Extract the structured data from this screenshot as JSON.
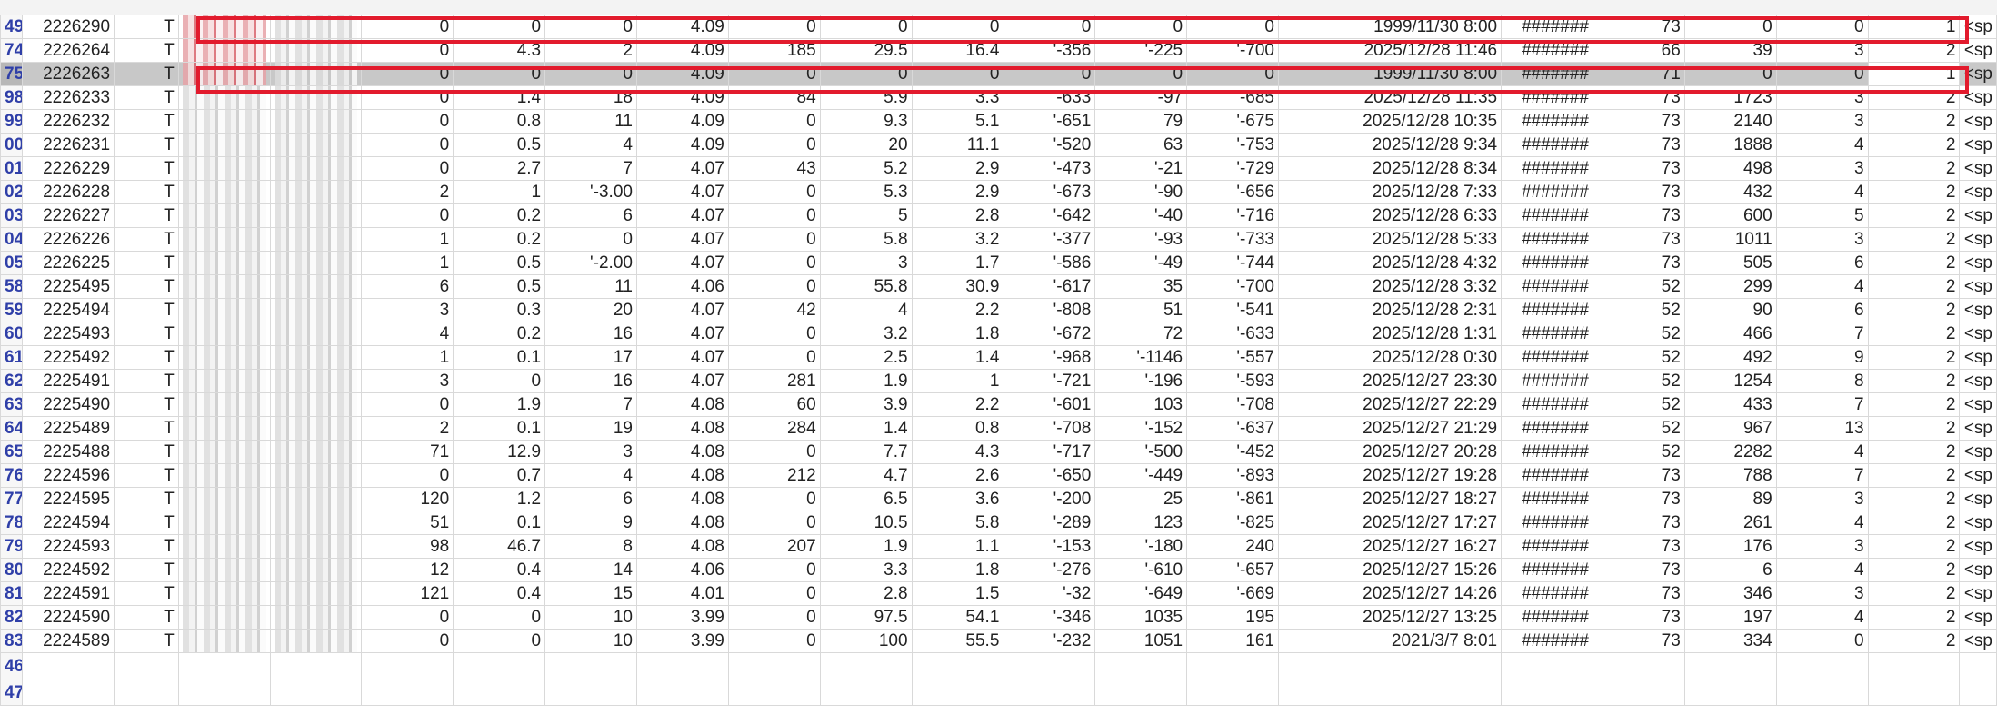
{
  "accent_colors": {
    "highlight": "#e21b2d",
    "row_number_text": "#2f3fa8",
    "selected_row": "#c8c8c8"
  },
  "rows": [
    {
      "rownum": "49",
      "id": "2226290",
      "prefix": "T",
      "c4": "0",
      "c5": "0",
      "c6": "0",
      "c7": "4.09",
      "c8": "0",
      "c9": "0",
      "c10": "0",
      "c11": "0",
      "c12": "0",
      "c13": "0",
      "date": "1999/11/30 8:00",
      "hash": "#######",
      "c16": "73",
      "c17": "0",
      "c18": "0",
      "c19": "1",
      "tail": "<sp",
      "highlight": true,
      "selected": false,
      "redblur": true
    },
    {
      "rownum": "74",
      "id": "2226264",
      "prefix": "T",
      "c4": "0",
      "c5": "4.3",
      "c6": "2",
      "c7": "4.09",
      "c8": "185",
      "c9": "29.5",
      "c10": "16.4",
      "c11": "'-356",
      "c12": "'-225",
      "c13": "'-700",
      "date": "2025/12/28 11:46",
      "hash": "#######",
      "c16": "66",
      "c17": "39",
      "c18": "3",
      "c19": "2",
      "tail": "<sp",
      "highlight": false,
      "selected": false,
      "redblur": true
    },
    {
      "rownum": "75",
      "id": "2226263",
      "prefix": "T",
      "c4": "0",
      "c5": "0",
      "c6": "0",
      "c7": "4.09",
      "c8": "0",
      "c9": "0",
      "c10": "0",
      "c11": "0",
      "c12": "0",
      "c13": "0",
      "date": "1999/11/30 8:00",
      "hash": "#######",
      "c16": "71",
      "c17": "0",
      "c18": "0",
      "c19": "1",
      "tail": "<sp",
      "highlight": true,
      "selected": true,
      "redblur": true
    },
    {
      "rownum": "98",
      "id": "2226233",
      "prefix": "T",
      "c4": "0",
      "c5": "1.4",
      "c6": "18",
      "c7": "4.09",
      "c8": "84",
      "c9": "5.9",
      "c10": "3.3",
      "c11": "'-633",
      "c12": "'-97",
      "c13": "'-685",
      "date": "2025/12/28 11:35",
      "hash": "#######",
      "c16": "73",
      "c17": "1723",
      "c18": "3",
      "c19": "2",
      "tail": "<sp"
    },
    {
      "rownum": "99",
      "id": "2226232",
      "prefix": "T",
      "c4": "0",
      "c5": "0.8",
      "c6": "11",
      "c7": "4.09",
      "c8": "0",
      "c9": "9.3",
      "c10": "5.1",
      "c11": "'-651",
      "c12": "79",
      "c13": "'-675",
      "date": "2025/12/28 10:35",
      "hash": "#######",
      "c16": "73",
      "c17": "2140",
      "c18": "3",
      "c19": "2",
      "tail": "<sp"
    },
    {
      "rownum": "00",
      "id": "2226231",
      "prefix": "T",
      "c4": "0",
      "c5": "0.5",
      "c6": "4",
      "c7": "4.09",
      "c8": "0",
      "c9": "20",
      "c10": "11.1",
      "c11": "'-520",
      "c12": "63",
      "c13": "'-753",
      "date": "2025/12/28 9:34",
      "hash": "#######",
      "c16": "73",
      "c17": "1888",
      "c18": "4",
      "c19": "2",
      "tail": "<sp"
    },
    {
      "rownum": "01",
      "id": "2226229",
      "prefix": "T",
      "c4": "0",
      "c5": "2.7",
      "c6": "7",
      "c7": "4.07",
      "c8": "43",
      "c9": "5.2",
      "c10": "2.9",
      "c11": "'-473",
      "c12": "'-21",
      "c13": "'-729",
      "date": "2025/12/28 8:34",
      "hash": "#######",
      "c16": "73",
      "c17": "498",
      "c18": "3",
      "c19": "2",
      "tail": "<sp"
    },
    {
      "rownum": "02",
      "id": "2226228",
      "prefix": "T",
      "c4": "2",
      "c5": "1",
      "c6": "'-3.00",
      "c7": "4.07",
      "c8": "0",
      "c9": "5.3",
      "c10": "2.9",
      "c11": "'-673",
      "c12": "'-90",
      "c13": "'-656",
      "date": "2025/12/28 7:33",
      "hash": "#######",
      "c16": "73",
      "c17": "432",
      "c18": "4",
      "c19": "2",
      "tail": "<sp",
      "c6left": true
    },
    {
      "rownum": "03",
      "id": "2226227",
      "prefix": "T",
      "c4": "0",
      "c5": "0.2",
      "c6": "6",
      "c7": "4.07",
      "c8": "0",
      "c9": "5",
      "c10": "2.8",
      "c11": "'-642",
      "c12": "'-40",
      "c13": "'-716",
      "date": "2025/12/28 6:33",
      "hash": "#######",
      "c16": "73",
      "c17": "600",
      "c18": "5",
      "c19": "2",
      "tail": "<sp"
    },
    {
      "rownum": "04",
      "id": "2226226",
      "prefix": "T",
      "c4": "1",
      "c5": "0.2",
      "c6": "0",
      "c7": "4.07",
      "c8": "0",
      "c9": "5.8",
      "c10": "3.2",
      "c11": "'-377",
      "c12": "'-93",
      "c13": "'-733",
      "date": "2025/12/28 5:33",
      "hash": "#######",
      "c16": "73",
      "c17": "1011",
      "c18": "3",
      "c19": "2",
      "tail": "<sp"
    },
    {
      "rownum": "05",
      "id": "2226225",
      "prefix": "T",
      "c4": "1",
      "c5": "0.5",
      "c6": "'-2.00",
      "c7": "4.07",
      "c8": "0",
      "c9": "3",
      "c10": "1.7",
      "c11": "'-586",
      "c12": "'-49",
      "c13": "'-744",
      "date": "2025/12/28 4:32",
      "hash": "#######",
      "c16": "73",
      "c17": "505",
      "c18": "6",
      "c19": "2",
      "tail": "<sp",
      "c6left": true
    },
    {
      "rownum": "58",
      "id": "2225495",
      "prefix": "T",
      "c4": "6",
      "c5": "0.5",
      "c6": "11",
      "c7": "4.06",
      "c8": "0",
      "c9": "55.8",
      "c10": "30.9",
      "c11": "'-617",
      "c12": "35",
      "c13": "'-700",
      "date": "2025/12/28 3:32",
      "hash": "#######",
      "c16": "52",
      "c17": "299",
      "c18": "4",
      "c19": "2",
      "tail": "<sp"
    },
    {
      "rownum": "59",
      "id": "2225494",
      "prefix": "T",
      "c4": "3",
      "c5": "0.3",
      "c6": "20",
      "c7": "4.07",
      "c8": "42",
      "c9": "4",
      "c10": "2.2",
      "c11": "'-808",
      "c12": "51",
      "c13": "'-541",
      "date": "2025/12/28 2:31",
      "hash": "#######",
      "c16": "52",
      "c17": "90",
      "c18": "6",
      "c19": "2",
      "tail": "<sp"
    },
    {
      "rownum": "60",
      "id": "2225493",
      "prefix": "T",
      "c4": "4",
      "c5": "0.2",
      "c6": "16",
      "c7": "4.07",
      "c8": "0",
      "c9": "3.2",
      "c10": "1.8",
      "c11": "'-672",
      "c12": "72",
      "c13": "'-633",
      "date": "2025/12/28 1:31",
      "hash": "#######",
      "c16": "52",
      "c17": "466",
      "c18": "7",
      "c19": "2",
      "tail": "<sp"
    },
    {
      "rownum": "61",
      "id": "2225492",
      "prefix": "T",
      "c4": "1",
      "c5": "0.1",
      "c6": "17",
      "c7": "4.07",
      "c8": "0",
      "c9": "2.5",
      "c10": "1.4",
      "c11": "'-968",
      "c12": "'-1146",
      "c13": "'-557",
      "date": "2025/12/28 0:30",
      "hash": "#######",
      "c16": "52",
      "c17": "492",
      "c18": "9",
      "c19": "2",
      "tail": "<sp"
    },
    {
      "rownum": "62",
      "id": "2225491",
      "prefix": "T",
      "c4": "3",
      "c5": "0",
      "c6": "16",
      "c7": "4.07",
      "c8": "281",
      "c9": "1.9",
      "c10": "1",
      "c11": "'-721",
      "c12": "'-196",
      "c13": "'-593",
      "date": "2025/12/27 23:30",
      "hash": "#######",
      "c16": "52",
      "c17": "1254",
      "c18": "8",
      "c19": "2",
      "tail": "<sp"
    },
    {
      "rownum": "63",
      "id": "2225490",
      "prefix": "T",
      "c4": "0",
      "c5": "1.9",
      "c6": "7",
      "c7": "4.08",
      "c8": "60",
      "c9": "3.9",
      "c10": "2.2",
      "c11": "'-601",
      "c12": "103",
      "c13": "'-708",
      "date": "2025/12/27 22:29",
      "hash": "#######",
      "c16": "52",
      "c17": "433",
      "c18": "7",
      "c19": "2",
      "tail": "<sp"
    },
    {
      "rownum": "64",
      "id": "2225489",
      "prefix": "T",
      "c4": "2",
      "c5": "0.1",
      "c6": "19",
      "c7": "4.08",
      "c8": "284",
      "c9": "1.4",
      "c10": "0.8",
      "c11": "'-708",
      "c12": "'-152",
      "c13": "'-637",
      "date": "2025/12/27 21:29",
      "hash": "#######",
      "c16": "52",
      "c17": "967",
      "c18": "13",
      "c19": "2",
      "tail": "<sp"
    },
    {
      "rownum": "65",
      "id": "2225488",
      "prefix": "T",
      "c4": "71",
      "c5": "12.9",
      "c6": "3",
      "c7": "4.08",
      "c8": "0",
      "c9": "7.7",
      "c10": "4.3",
      "c11": "'-717",
      "c12": "'-500",
      "c13": "'-452",
      "date": "2025/12/27 20:28",
      "hash": "#######",
      "c16": "52",
      "c17": "2282",
      "c18": "4",
      "c19": "2",
      "tail": "<sp"
    },
    {
      "rownum": "76",
      "id": "2224596",
      "prefix": "T",
      "c4": "0",
      "c5": "0.7",
      "c6": "4",
      "c7": "4.08",
      "c8": "212",
      "c9": "4.7",
      "c10": "2.6",
      "c11": "'-650",
      "c12": "'-449",
      "c13": "'-893",
      "date": "2025/12/27 19:28",
      "hash": "#######",
      "c16": "73",
      "c17": "788",
      "c18": "7",
      "c19": "2",
      "tail": "<sp"
    },
    {
      "rownum": "77",
      "id": "2224595",
      "prefix": "T",
      "c4": "120",
      "c5": "1.2",
      "c6": "6",
      "c7": "4.08",
      "c8": "0",
      "c9": "6.5",
      "c10": "3.6",
      "c11": "'-200",
      "c12": "25",
      "c13": "'-861",
      "date": "2025/12/27 18:27",
      "hash": "#######",
      "c16": "73",
      "c17": "89",
      "c18": "3",
      "c19": "2",
      "tail": "<sp"
    },
    {
      "rownum": "78",
      "id": "2224594",
      "prefix": "T",
      "c4": "51",
      "c5": "0.1",
      "c6": "9",
      "c7": "4.08",
      "c8": "0",
      "c9": "10.5",
      "c10": "5.8",
      "c11": "'-289",
      "c12": "123",
      "c13": "'-825",
      "date": "2025/12/27 17:27",
      "hash": "#######",
      "c16": "73",
      "c17": "261",
      "c18": "4",
      "c19": "2",
      "tail": "<sp"
    },
    {
      "rownum": "79",
      "id": "2224593",
      "prefix": "T",
      "c4": "98",
      "c5": "46.7",
      "c6": "8",
      "c7": "4.08",
      "c8": "207",
      "c9": "1.9",
      "c10": "1.1",
      "c11": "'-153",
      "c12": "'-180",
      "c13": "240",
      "date": "2025/12/27 16:27",
      "hash": "#######",
      "c16": "73",
      "c17": "176",
      "c18": "3",
      "c19": "2",
      "tail": "<sp"
    },
    {
      "rownum": "80",
      "id": "2224592",
      "prefix": "T",
      "c4": "12",
      "c5": "0.4",
      "c6": "14",
      "c7": "4.06",
      "c8": "0",
      "c9": "3.3",
      "c10": "1.8",
      "c11": "'-276",
      "c12": "'-610",
      "c13": "'-657",
      "date": "2025/12/27 15:26",
      "hash": "#######",
      "c16": "73",
      "c17": "6",
      "c18": "4",
      "c19": "2",
      "tail": "<sp"
    },
    {
      "rownum": "81",
      "id": "2224591",
      "prefix": "T",
      "c4": "121",
      "c5": "0.4",
      "c6": "15",
      "c7": "4.01",
      "c8": "0",
      "c9": "2.8",
      "c10": "1.5",
      "c11": "'-32",
      "c12": "'-649",
      "c13": "'-669",
      "date": "2025/12/27 14:26",
      "hash": "#######",
      "c16": "73",
      "c17": "346",
      "c18": "3",
      "c19": "2",
      "tail": "<sp"
    },
    {
      "rownum": "82",
      "id": "2224590",
      "prefix": "T",
      "c4": "0",
      "c5": "0",
      "c6": "10",
      "c7": "3.99",
      "c8": "0",
      "c9": "97.5",
      "c10": "54.1",
      "c11": "'-346",
      "c12": "1035",
      "c13": "195",
      "date": "2025/12/27 13:25",
      "hash": "#######",
      "c16": "73",
      "c17": "197",
      "c18": "4",
      "c19": "2",
      "tail": "<sp"
    },
    {
      "rownum": "83",
      "id": "2224589",
      "prefix": "T",
      "c4": "0",
      "c5": "0",
      "c6": "10",
      "c7": "3.99",
      "c8": "0",
      "c9": "100",
      "c10": "55.5",
      "c11": "'-232",
      "c12": "1051",
      "c13": "161",
      "date": "2021/3/7 8:01",
      "hash": "#######",
      "c16": "73",
      "c17": "334",
      "c18": "0",
      "c19": "2",
      "tail": "<sp"
    }
  ],
  "empty_rows": [
    "46",
    "47"
  ]
}
